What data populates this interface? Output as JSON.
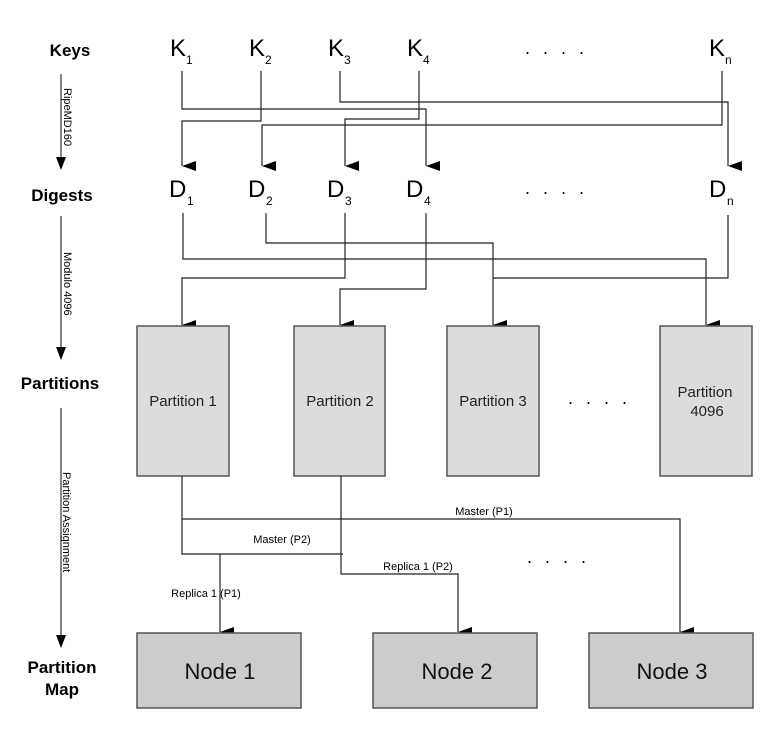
{
  "stages": {
    "keys": "Keys",
    "digests": "Digests",
    "partitions": "Partitions",
    "partition_map_line1": "Partition",
    "partition_map_line2": "Map"
  },
  "transforms": {
    "hash": "RipeMD160",
    "modulo": "Modulo 4096",
    "assignment": "Partition Assignment"
  },
  "keys": [
    {
      "letter": "K",
      "sub": "1"
    },
    {
      "letter": "K",
      "sub": "2"
    },
    {
      "letter": "K",
      "sub": "3"
    },
    {
      "letter": "K",
      "sub": "4"
    },
    {
      "letter": "K",
      "sub": "n"
    }
  ],
  "digests": [
    {
      "letter": "D",
      "sub": "1"
    },
    {
      "letter": "D",
      "sub": "2"
    },
    {
      "letter": "D",
      "sub": "3"
    },
    {
      "letter": "D",
      "sub": "4"
    },
    {
      "letter": "D",
      "sub": "n"
    }
  ],
  "ellipsis": ". . . .",
  "partitions": [
    {
      "label": "Partition 1"
    },
    {
      "label": "Partition 2"
    },
    {
      "label": "Partition 3"
    },
    {
      "label_line1": "Partition",
      "label_line2": "4096"
    }
  ],
  "nodes": [
    "Node 1",
    "Node 2",
    "Node 3"
  ],
  "edges": {
    "master_p1": "Master (P1)",
    "master_p2": "Master (P2)",
    "replica1_p2": "Replica 1 (P2)",
    "replica1_p1": "Replica 1 (P1)"
  },
  "colors": {
    "partition_fill": "#dcdcdc",
    "node_fill": "#cccccc"
  }
}
